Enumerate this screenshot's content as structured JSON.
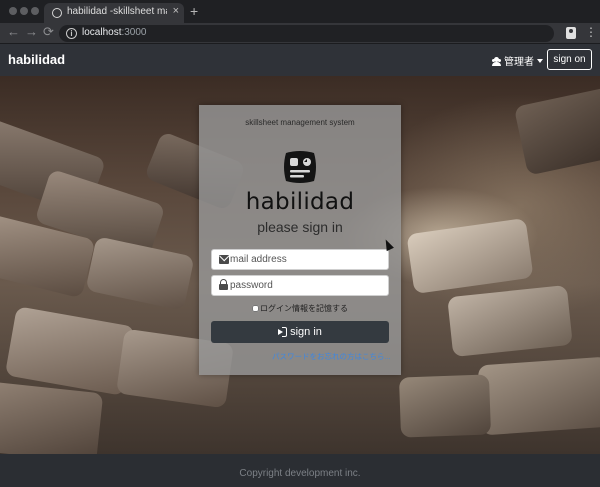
{
  "browser": {
    "tab_title": "habilidad -skillsheet management",
    "tab_close": "×",
    "new_tab": "+",
    "url_host": "localhost",
    "url_port": ":3000",
    "nav": {
      "back": "←",
      "forward": "→",
      "reload": "⟳"
    },
    "menu": "⋮",
    "info": "i"
  },
  "navbar": {
    "brand": "habilidad",
    "admin_label": "管理者",
    "sign_on_label": "sign on"
  },
  "login": {
    "system_label": "skillsheet management system",
    "logo_text": "habilidad",
    "heading": "please sign in",
    "email_placeholder": "mail address",
    "password_placeholder": "password",
    "remember_label": "ログイン情報を記憶する",
    "submit_label": "sign in",
    "forgot_link": "パスワードをお忘れの方はこちら..."
  },
  "footer": {
    "copyright": "Copyright development inc."
  },
  "colors": {
    "navbar_bg": "#2f3238",
    "button_dark": "#343a40",
    "link_blue": "#3f87e0",
    "card_bg": "rgba(150,150,150,0.82)"
  },
  "icons": [
    "globe-icon",
    "close-icon",
    "plus-icon",
    "back-arrow-icon",
    "forward-arrow-icon",
    "reload-icon",
    "info-icon",
    "profile-icon",
    "menu-icon",
    "users-icon",
    "caret-down-icon",
    "logo-icon",
    "envelope-icon",
    "lock-icon",
    "sign-in-icon",
    "mouse-cursor-icon"
  ]
}
